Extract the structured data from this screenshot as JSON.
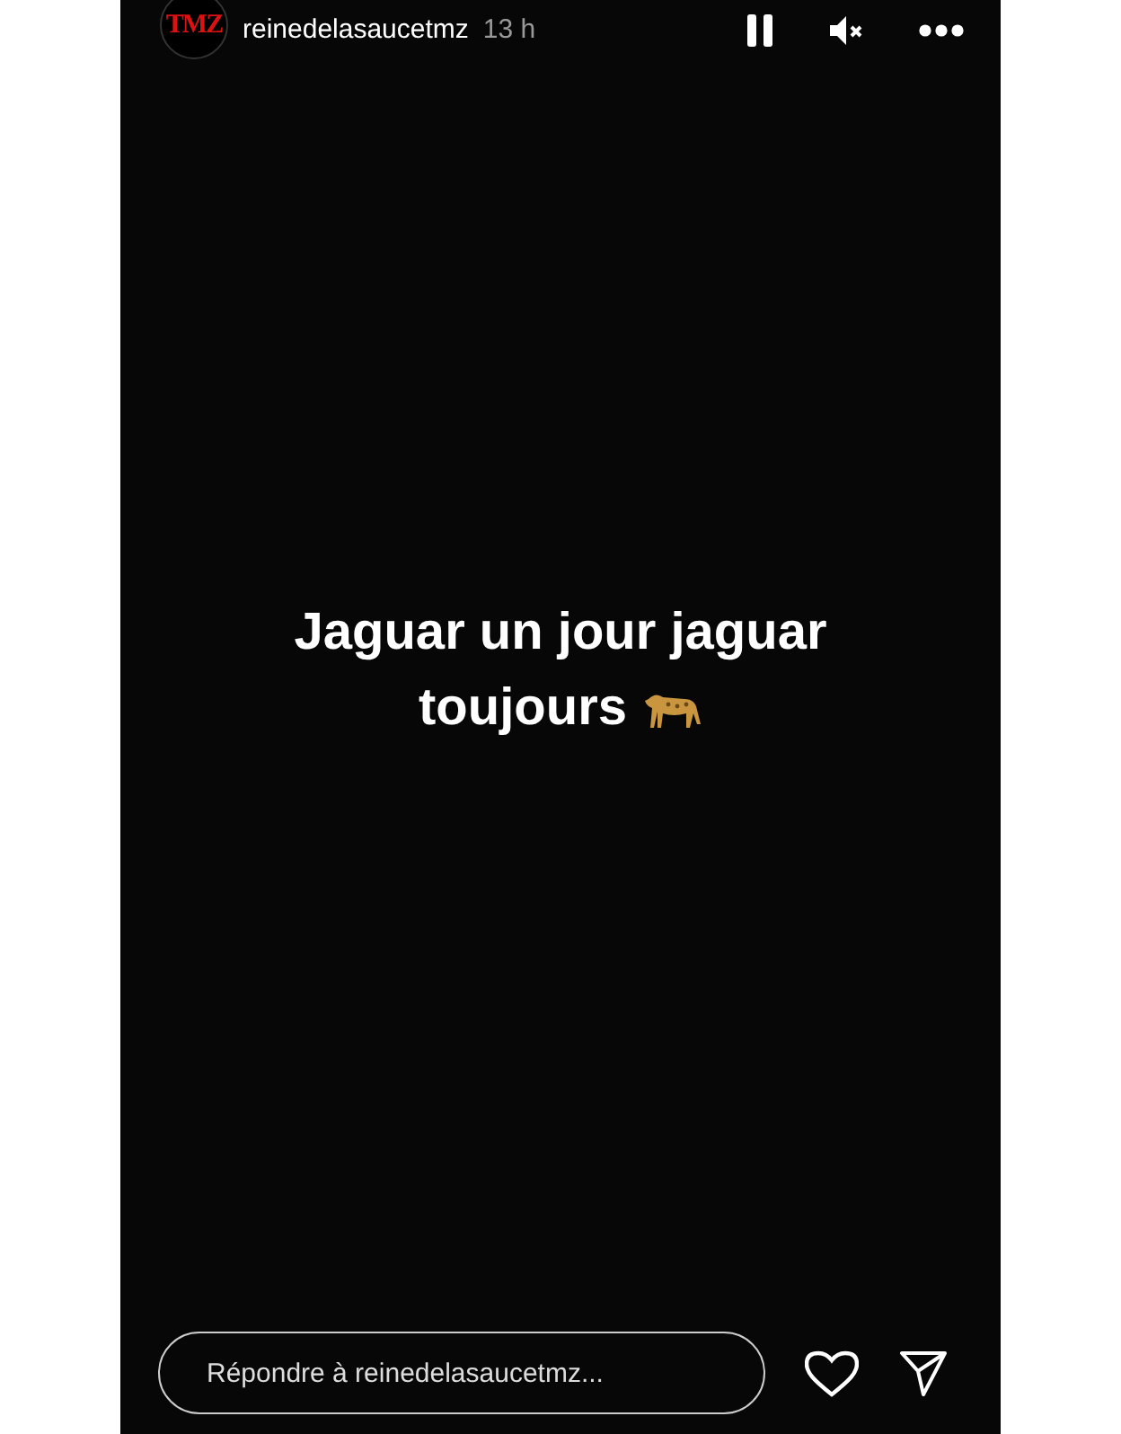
{
  "story": {
    "avatar_text": "TMZ",
    "username": "reinedelasaucetmz",
    "time": "13 h",
    "paused": false,
    "muted": true
  },
  "caption": {
    "lines": [
      "Jaguar un jour jaguar",
      "toujours"
    ]
  },
  "reply": {
    "placeholder": "Répondre à reinedelasaucetmz..."
  }
}
